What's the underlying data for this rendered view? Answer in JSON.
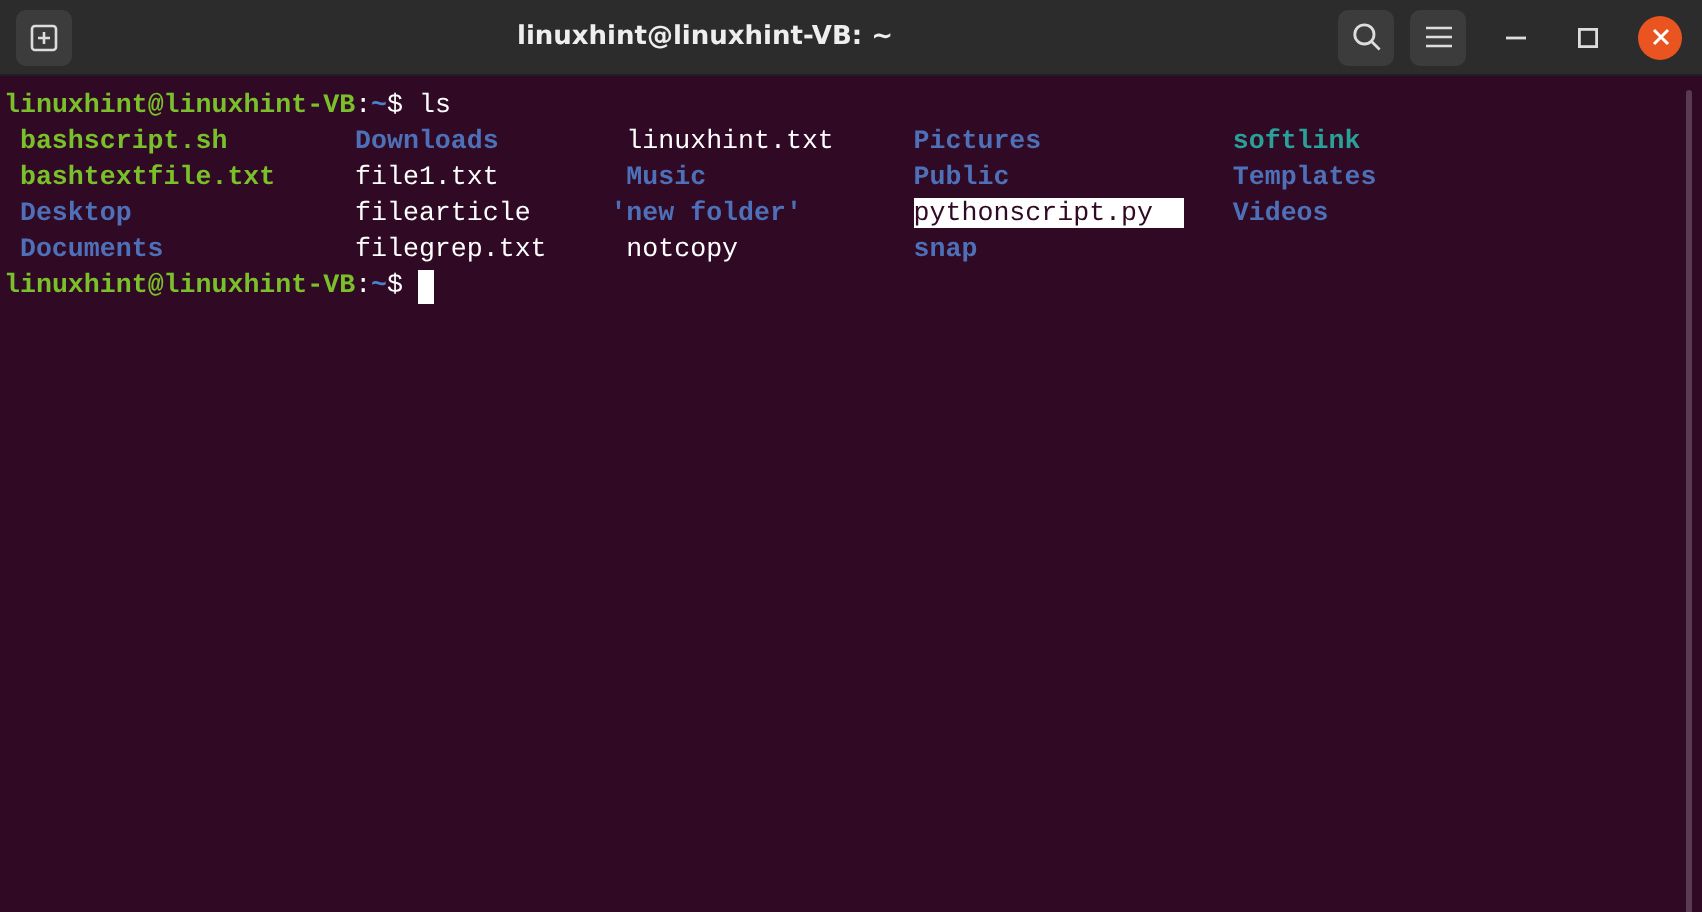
{
  "window": {
    "title": "linuxhint@linuxhint-VB: ~"
  },
  "lines": [
    {
      "kind": "prompt",
      "user_host": "linuxhint@linuxhint-VB",
      "separator": ":",
      "path": "~",
      "symbol": "$",
      "command": "ls",
      "cursor": false
    },
    {
      "kind": "listing",
      "columns": [
        [
          {
            "name": "bashscript.sh",
            "kind": "executable",
            "quoted": false
          },
          {
            "name": "bashtextfile.txt",
            "kind": "executable",
            "quoted": false
          },
          {
            "name": "Desktop",
            "kind": "directory",
            "quoted": false
          },
          {
            "name": "Documents",
            "kind": "directory",
            "quoted": false
          }
        ],
        [
          {
            "name": "Downloads",
            "kind": "directory",
            "quoted": false
          },
          {
            "name": "file1.txt",
            "kind": "file",
            "quoted": false
          },
          {
            "name": "filearticle",
            "kind": "file",
            "quoted": false
          },
          {
            "name": "filegrep.txt",
            "kind": "file",
            "quoted": false
          }
        ],
        [
          {
            "name": "linuxhint.txt",
            "kind": "file",
            "quoted": false
          },
          {
            "name": "Music",
            "kind": "directory",
            "quoted": false
          },
          {
            "name": "'new folder'",
            "kind": "directory",
            "quoted": true
          },
          {
            "name": "notcopy",
            "kind": "file",
            "quoted": false
          }
        ],
        [
          {
            "name": "Pictures",
            "kind": "directory",
            "quoted": false
          },
          {
            "name": "Public",
            "kind": "directory",
            "quoted": false
          },
          {
            "name": "pythonscript.py",
            "kind": "highlighted",
            "quoted": false
          },
          {
            "name": "snap",
            "kind": "directory",
            "quoted": false
          }
        ],
        [
          {
            "name": "softlink",
            "kind": "symlink",
            "quoted": false
          },
          {
            "name": "Templates",
            "kind": "directory",
            "quoted": false
          },
          {
            "name": "Videos",
            "kind": "directory",
            "quoted": false
          }
        ]
      ]
    },
    {
      "kind": "prompt",
      "user_host": "linuxhint@linuxhint-VB",
      "separator": ":",
      "path": "~",
      "symbol": "$",
      "cursor": true
    }
  ]
}
